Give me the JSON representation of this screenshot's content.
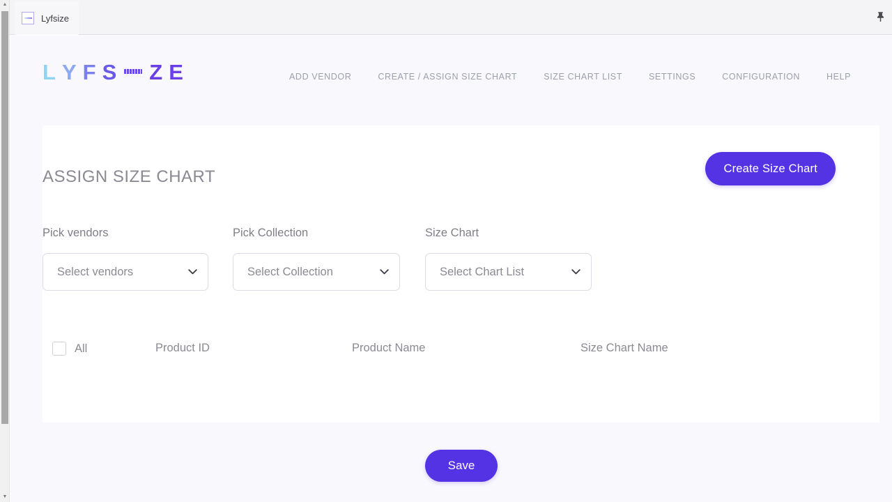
{
  "browser": {
    "tab_title": "Lyfsize",
    "favicon_name": "lyfsize-favicon",
    "pin_icon": "pushpin-icon",
    "scrollbar_up": "▲",
    "scrollbar_down": "▼"
  },
  "brand": {
    "logo_letters": [
      "L",
      "Y",
      "F",
      "S",
      "Z",
      "E"
    ],
    "logo_text": "LYFS-ZE",
    "colors": {
      "accent": "#5433e4",
      "logo_start": "#8fd4f2",
      "logo_end": "#6a3fe6",
      "page_bg": "#f8f8fd",
      "card_bg": "#ffffff",
      "muted_text": "#8a8a93",
      "nav_text": "#9ca0ab",
      "border": "#dcdce4"
    }
  },
  "nav": {
    "items": [
      {
        "label": "ADD VENDOR",
        "name": "nav-add-vendor"
      },
      {
        "label": "CREATE / ASSIGN SIZE CHART",
        "name": "nav-create-assign-size-chart"
      },
      {
        "label": "SIZE CHART LIST",
        "name": "nav-size-chart-list"
      },
      {
        "label": "SETTINGS",
        "name": "nav-settings"
      },
      {
        "label": "CONFIGURATION",
        "name": "nav-configuration"
      },
      {
        "label": "HELP",
        "name": "nav-help"
      }
    ]
  },
  "page": {
    "title": "ASSIGN SIZE CHART",
    "create_button": "Create Size Chart",
    "save_button": "Save"
  },
  "filters": [
    {
      "label": "Pick vendors",
      "value": "Select vendors",
      "options": [
        "Select vendors"
      ],
      "name": "vendors"
    },
    {
      "label": "Pick Collection",
      "value": "Select Collection",
      "options": [
        "Select Collection"
      ],
      "name": "collection"
    },
    {
      "label": "Size Chart",
      "value": "Select Chart List",
      "options": [
        "Select Chart List"
      ],
      "name": "size-chart"
    }
  ],
  "table": {
    "select_all_label": "All",
    "select_all_checked": false,
    "columns": [
      "Product ID",
      "Product Name",
      "Size Chart Name"
    ],
    "rows": []
  }
}
